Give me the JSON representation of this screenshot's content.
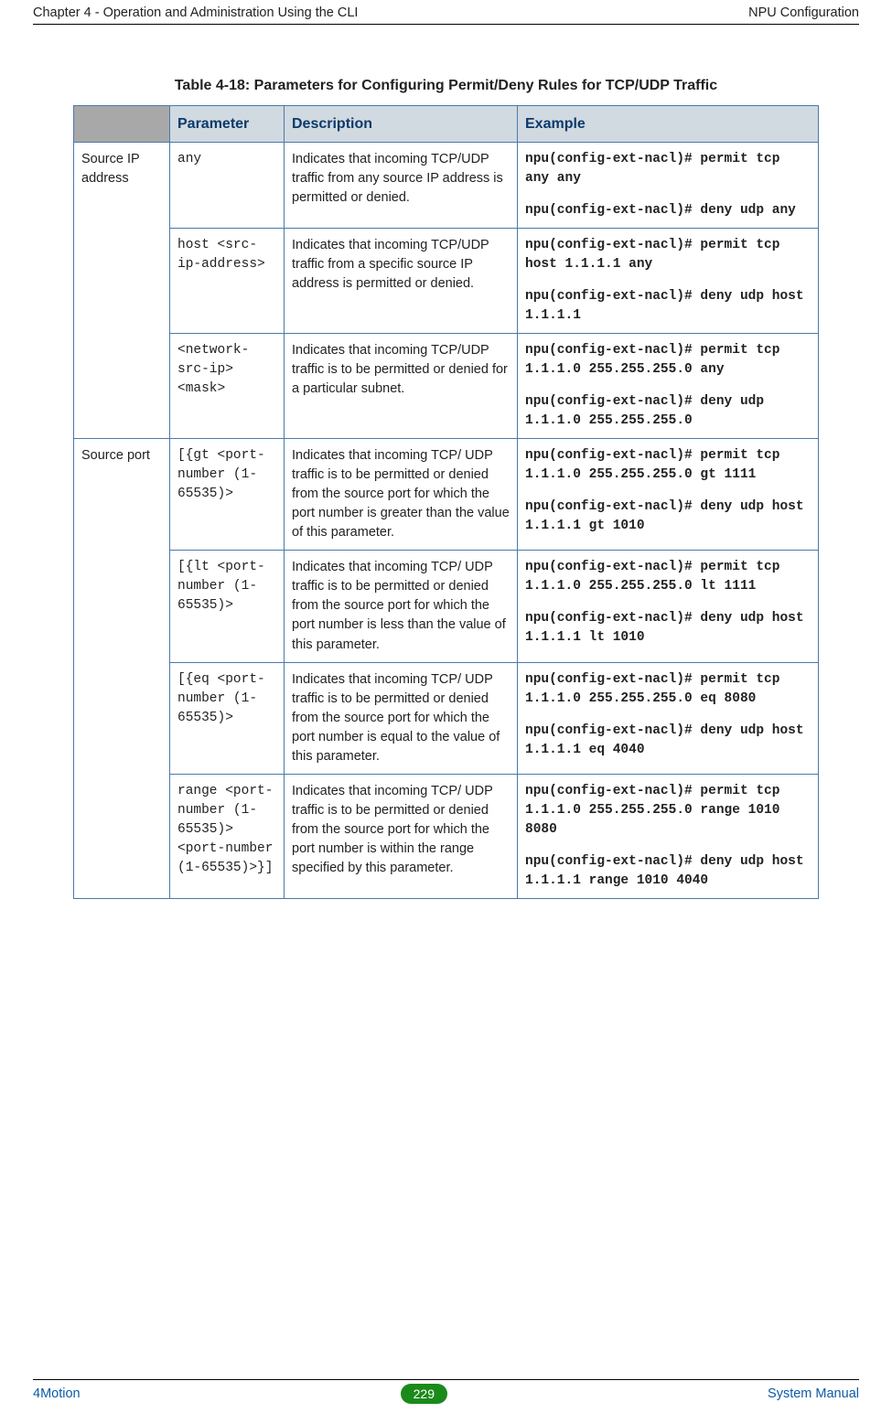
{
  "header": {
    "left": "Chapter 4 - Operation and Administration Using the CLI",
    "right": "NPU Configuration"
  },
  "table": {
    "caption": "Table 4-18: Parameters for Configuring Permit/Deny Rules for TCP/UDP Traffic",
    "head": {
      "parameter": "Parameter",
      "description": "Description",
      "example": "Example"
    },
    "group_source_ip": "Source IP address",
    "group_source_port": "Source port",
    "rows": [
      {
        "param": "any",
        "desc": "Indicates that incoming TCP/UDP traffic from any source IP address is permitted or denied.",
        "ex1": "npu(config-ext-nacl)# permit tcp any any",
        "ex2": "npu(config-ext-nacl)# deny udp any"
      },
      {
        "param": "host <src-ip-address>",
        "desc": "Indicates that incoming TCP/UDP traffic from a specific source IP address is permitted or denied.",
        "ex1": "npu(config-ext-nacl)# permit tcp host 1.1.1.1 any",
        "ex2": "npu(config-ext-nacl)# deny udp host 1.1.1.1"
      },
      {
        "param": "<network-src-ip> <mask>",
        "desc": "Indicates that incoming TCP/UDP traffic is to be permitted or denied for a particular subnet.",
        "ex1": "npu(config-ext-nacl)# permit tcp 1.1.1.0 255.255.255.0 any",
        "ex2": "npu(config-ext-nacl)# deny udp 1.1.1.0 255.255.255.0"
      },
      {
        "param": "[{gt <port-number (1-65535)>",
        "desc": "Indicates that incoming TCP/ UDP traffic is to be permitted or denied from the source port for which the port number is greater than the value of this parameter.",
        "ex1": "npu(config-ext-nacl)# permit tcp 1.1.1.0 255.255.255.0 gt 1111",
        "ex2": "npu(config-ext-nacl)# deny udp host 1.1.1.1 gt 1010"
      },
      {
        "param": "[{lt <port-number (1-65535)>",
        "desc": "Indicates that incoming TCP/ UDP traffic is to be permitted or denied from the source port for which the port number is less than the value of this parameter.",
        "ex1": "npu(config-ext-nacl)# permit tcp 1.1.1.0 255.255.255.0 lt 1111",
        "ex2": "npu(config-ext-nacl)# deny udp host 1.1.1.1 lt 1010"
      },
      {
        "param": "[{eq <port-number (1-65535)>",
        "desc": "Indicates that incoming TCP/ UDP traffic is to be permitted or denied from the source port for which the port number is equal to the value of this parameter.",
        "ex1": "npu(config-ext-nacl)# permit tcp 1.1.1.0 255.255.255.0 eq 8080",
        "ex2": "npu(config-ext-nacl)# deny udp host 1.1.1.1 eq 4040"
      },
      {
        "param": "range <port-number (1-65535)> <port-number (1-65535)>}]",
        "desc": "Indicates that incoming TCP/ UDP traffic is to be permitted or denied from the source port for which the port number is within the range specified by this parameter.",
        "ex1": "npu(config-ext-nacl)# permit tcp 1.1.1.0 255.255.255.0 range 1010 8080",
        "ex2": "npu(config-ext-nacl)# deny udp host 1.1.1.1 range 1010 4040"
      }
    ]
  },
  "footer": {
    "left": "4Motion",
    "page": "229",
    "right": "System Manual"
  }
}
